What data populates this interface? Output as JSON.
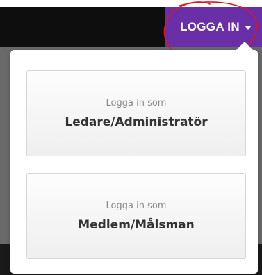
{
  "header": {
    "login_label": "LOGGA IN",
    "colors": {
      "navbar": "#0e0e0e",
      "login_button": "#6a2ea7",
      "annotation": "#e0161c"
    }
  },
  "dropdown": {
    "options": [
      {
        "prefix": "Logga in som",
        "role": "Ledare/Administratör"
      },
      {
        "prefix": "Logga in som",
        "role": "Medlem/Målsman"
      }
    ]
  }
}
